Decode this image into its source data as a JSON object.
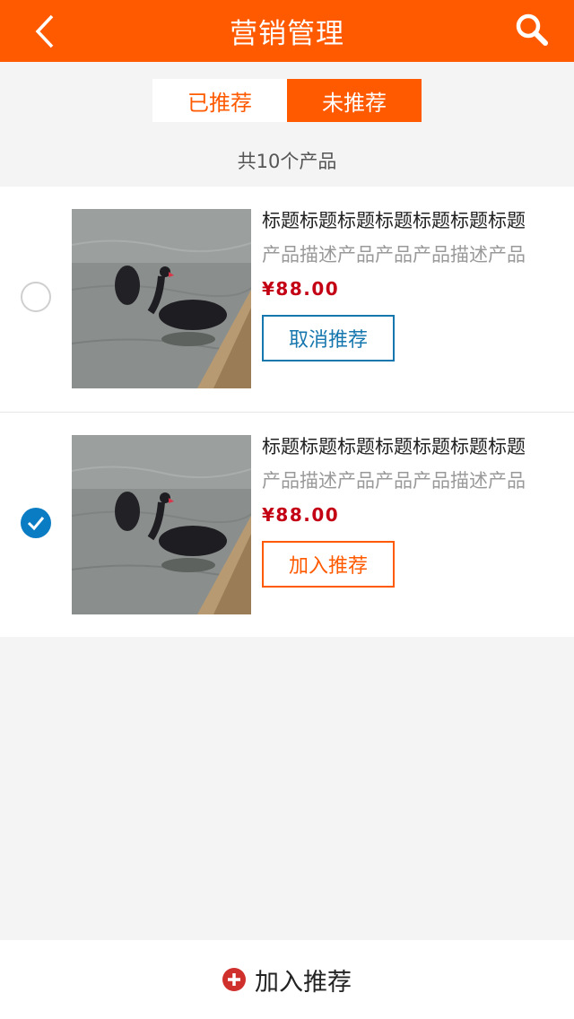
{
  "header": {
    "title": "营销管理",
    "back_icon": "chevron-left-icon",
    "search_icon": "search-icon",
    "color": "#ff5a00"
  },
  "tabs": [
    {
      "label": "已推荐",
      "active": false
    },
    {
      "label": "未推荐",
      "active": true
    }
  ],
  "summary": {
    "count_text": "共10个产品"
  },
  "products": [
    {
      "title": "标题标题标题标题标题标题标题",
      "description": "产品描述产品产品产品描述产品",
      "price": "¥88.00",
      "selected": false,
      "action_label": "取消推荐"
    },
    {
      "title": "标题标题标题标题标题标题标题",
      "description": "产品描述产品产品产品描述产品",
      "price": "¥88.00",
      "selected": true,
      "action_label": "加入推荐"
    }
  ],
  "footer": {
    "label": "加入推荐",
    "icon": "plus-circle-icon"
  },
  "colors": {
    "accent": "#ff5a00",
    "price": "#c40014",
    "select": "#0a7cc3",
    "cancel": "#1677ae"
  }
}
